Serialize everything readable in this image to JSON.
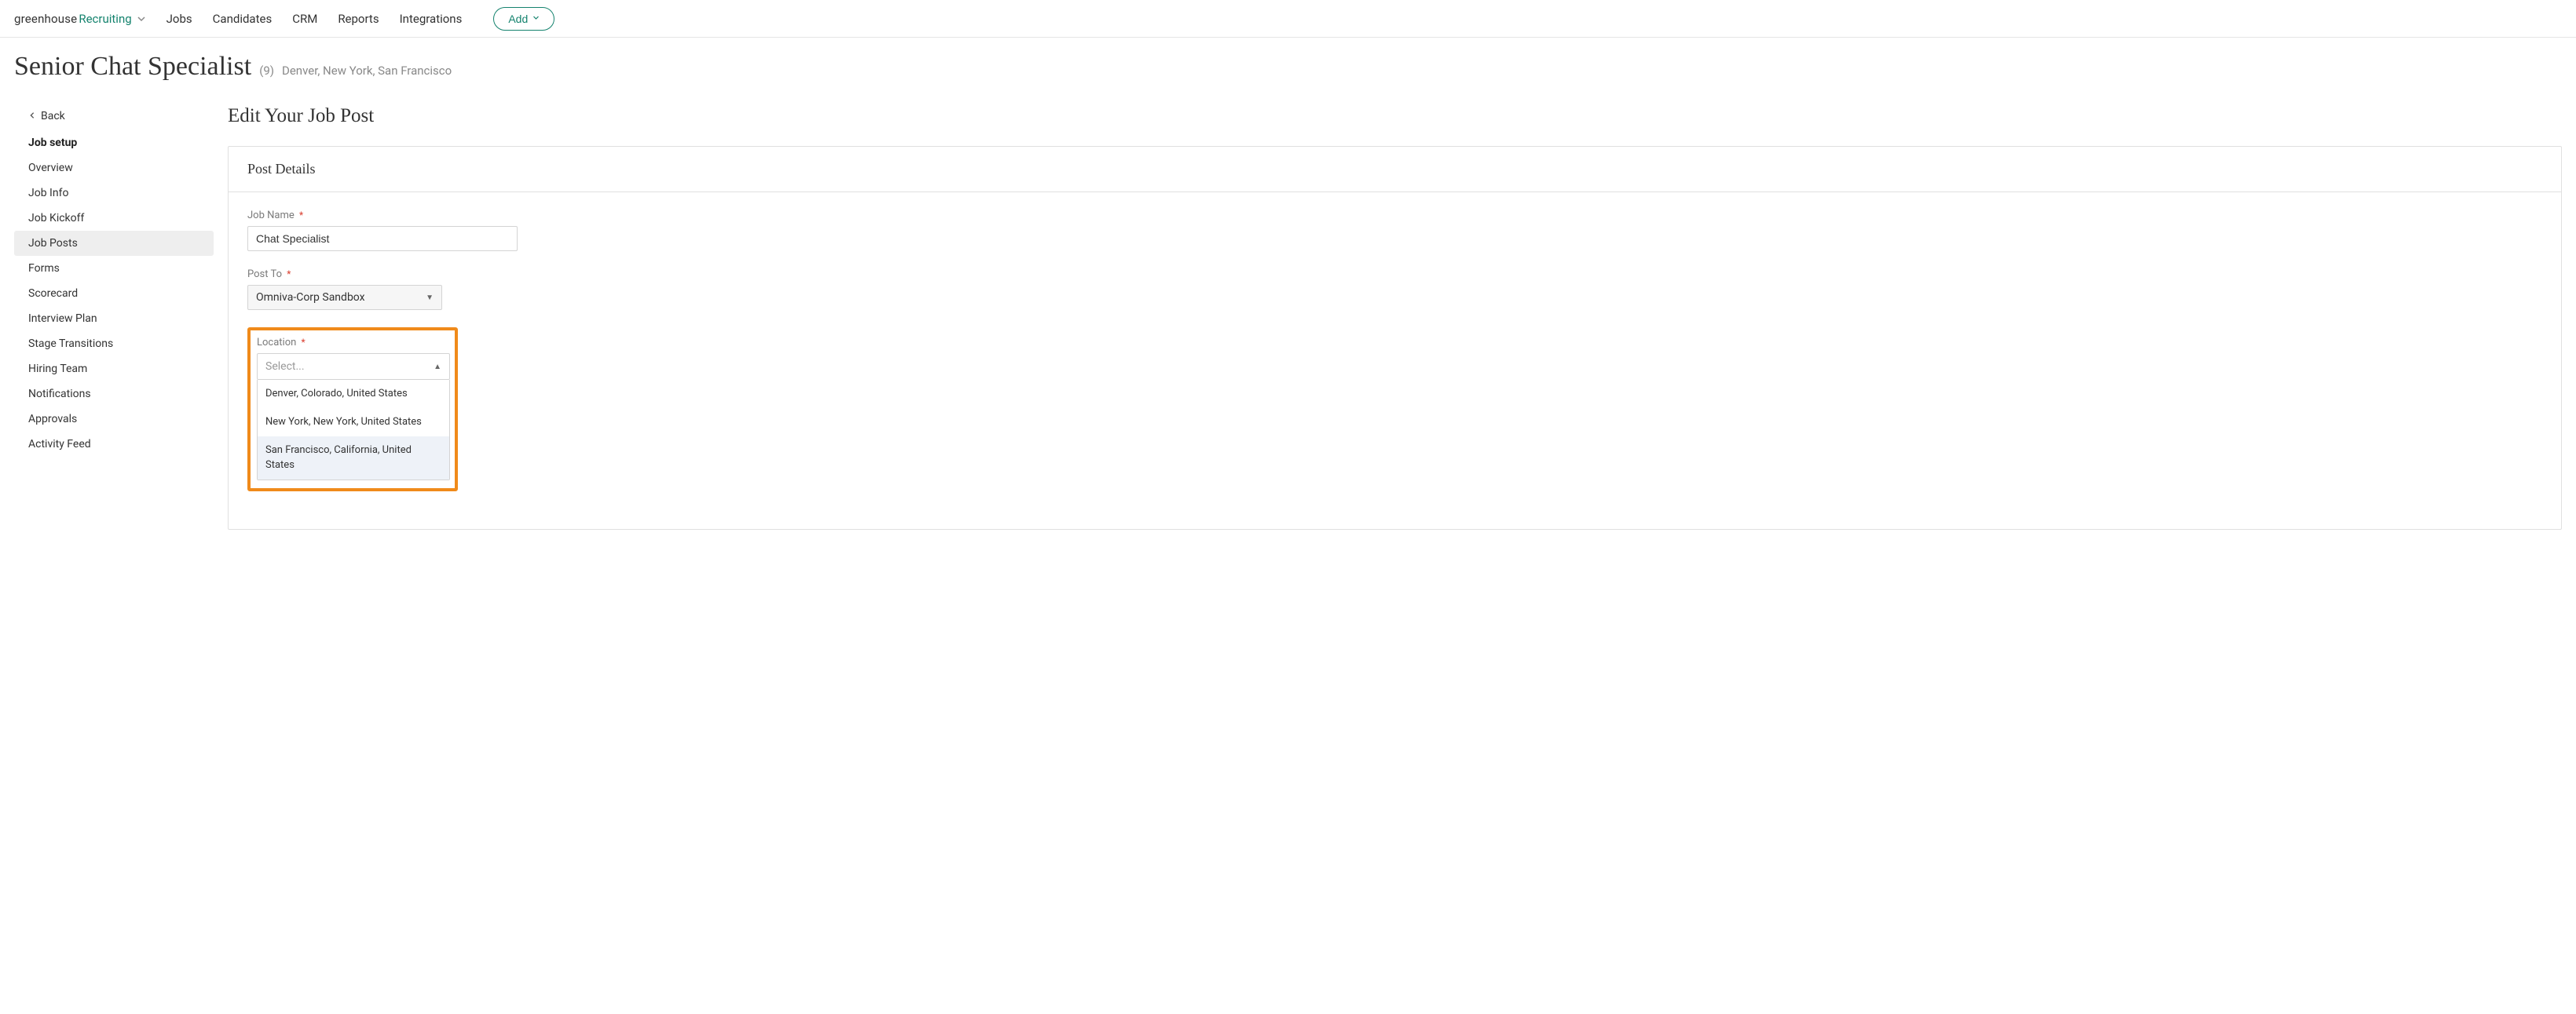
{
  "brand": {
    "a": "greenhouse",
    "b": "Recruiting"
  },
  "nav": {
    "jobs": "Jobs",
    "candidates": "Candidates",
    "crm": "CRM",
    "reports": "Reports",
    "integrations": "Integrations",
    "add": "Add"
  },
  "header": {
    "title": "Senior Chat Specialist",
    "count": "(9)",
    "locations": "Denver, New York, San Francisco"
  },
  "sidebar": {
    "back": "Back",
    "heading": "Job setup",
    "items": {
      "overview": "Overview",
      "jobinfo": "Job Info",
      "jobkickoff": "Job Kickoff",
      "jobposts": "Job Posts",
      "forms": "Forms",
      "scorecard": "Scorecard",
      "interviewplan": "Interview Plan",
      "stagetransitions": "Stage Transitions",
      "hiringteam": "Hiring Team",
      "notifications": "Notifications",
      "approvals": "Approvals",
      "activityfeed": "Activity Feed"
    }
  },
  "main": {
    "title": "Edit Your Job Post",
    "panel_header": "Post Details",
    "jobname_label": "Job Name",
    "jobname_value": "Chat Specialist",
    "postto_label": "Post To",
    "postto_value": "Omniva-Corp Sandbox",
    "location_label": "Location",
    "location_placeholder": "Select...",
    "location_options": [
      "Denver, Colorado, United States",
      "New York, New York, United States",
      "San Francisco, California, United States"
    ]
  }
}
